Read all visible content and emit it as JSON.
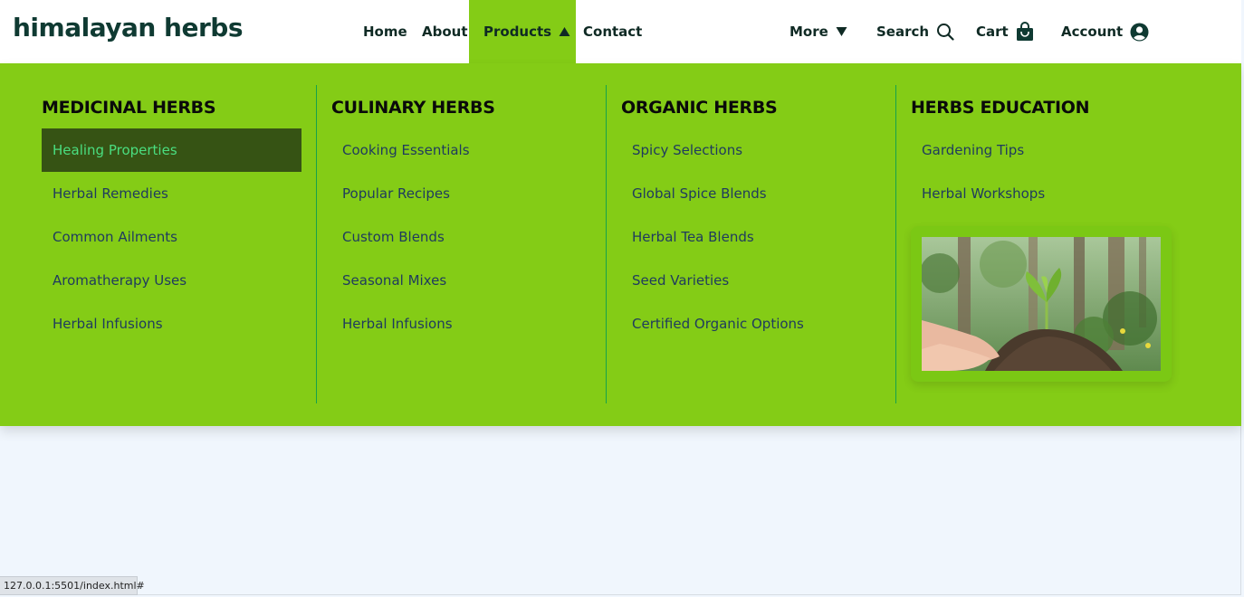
{
  "brand": "himalayan herbs",
  "nav": {
    "home": "Home",
    "about": "About",
    "products": "Products",
    "contact": "Contact",
    "more": "More",
    "search": "Search",
    "cart": "Cart",
    "account": "Account"
  },
  "columns": [
    {
      "title": "MEDICINAL HERBS",
      "links": [
        "Healing Properties",
        "Herbal Remedies",
        "Common Ailments",
        "Aromatherapy Uses",
        "Herbal Infusions"
      ],
      "selected_index": 0
    },
    {
      "title": "CULINARY HERBS",
      "links": [
        "Cooking Essentials",
        "Popular Recipes",
        "Custom Blends",
        "Seasonal Mixes",
        "Herbal Infusions"
      ]
    },
    {
      "title": "ORGANIC HERBS",
      "links": [
        "Spicy Selections",
        "Global Spice Blends",
        "Herbal Tea Blends",
        "Seed Varieties",
        "Certified Organic Options"
      ]
    },
    {
      "title": "HERBS EDUCATION",
      "links": [
        "Gardening Tips",
        "Herbal Workshops"
      ]
    }
  ],
  "status_url": "127.0.0.1:5501/index.html#",
  "colors": {
    "menu_bg": "#84cc16",
    "selected_bg": "#365314",
    "selected_text": "#4ade80",
    "link_text": "#1f3a5f",
    "page_bg": "#f0f6fd"
  }
}
